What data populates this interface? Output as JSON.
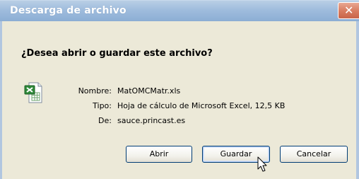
{
  "window": {
    "title": "Descarga de archivo",
    "close_glyph": "✕"
  },
  "dialog": {
    "question": "¿Desea abrir o guardar este archivo?",
    "file_icon": "excel-file-icon",
    "fields": {
      "name_label": "Nombre:",
      "name_value": "MatOMCMatr.xls",
      "type_label": "Tipo:",
      "type_value": "Hoja de cálculo de Microsoft Excel, 12,5 KB",
      "from_label": "De:",
      "from_value": "sauce.princast.es"
    }
  },
  "buttons": {
    "open": "Abrir",
    "save": "Guardar",
    "cancel": "Cancelar"
  },
  "colors": {
    "titlebar": "#9fbcdd",
    "close_button": "#d77a5e",
    "dialog_bg": "#ece9d8",
    "button_border": "#003c74"
  }
}
